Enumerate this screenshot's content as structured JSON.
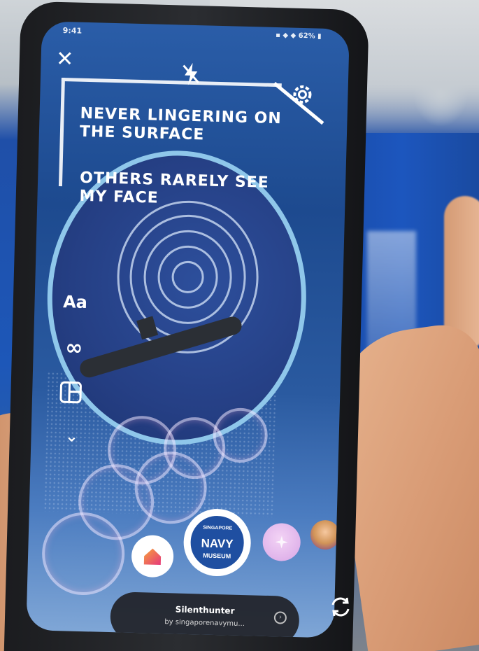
{
  "status_bar": {
    "time": "9:41",
    "indicators": "▪ ◆ ◆ 62% ▮"
  },
  "top_bar": {
    "close_label": "✕",
    "flash_icon": "flash-off-icon",
    "settings_icon": "gear-icon"
  },
  "lyrics": {
    "line1": "NEVER LINGERING ON THE SURFACE",
    "line2": "OTHERS RARELY SEE MY FACE"
  },
  "side_tools": {
    "text_label": "Aa",
    "boomerang_label": "∞",
    "layout_icon": "layout-icon",
    "more_label": "⌄"
  },
  "effects": {
    "home_icon": "home-icon",
    "selected": {
      "line1": "SINGAPORE",
      "line2": "NAVY",
      "line3": "MUSEUM"
    },
    "sparkle_icon": "sparkle-icon",
    "avatar_icon": "avatar-icon"
  },
  "effect_info": {
    "title": "Silenthunter",
    "subtitle": "by singaporenavymu..."
  },
  "colors": {
    "ring": "#8fc7ea",
    "museum_blue": "#1f4fa1"
  }
}
